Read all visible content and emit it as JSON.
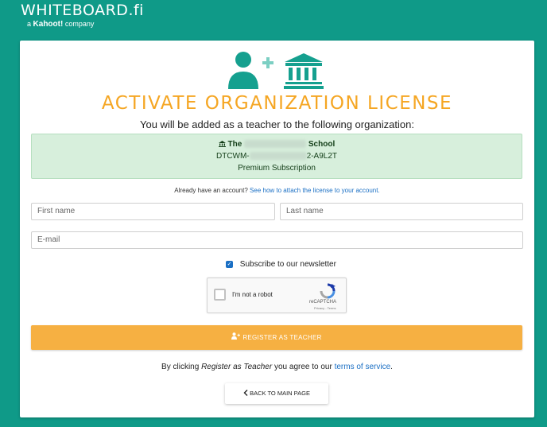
{
  "header": {
    "logo_text": "WHITEBOARD.fi",
    "tagline_prefix": "a",
    "tagline_brand": "Kahoot!",
    "tagline_suffix": "company"
  },
  "card": {
    "heading": "ACTIVATE ORGANIZATION LICENSE",
    "subheading": "You will be added as a teacher to the following organization:",
    "organization": {
      "name_prefix": "The",
      "name_suffix": "School",
      "code_prefix": "DTCWM-",
      "code_suffix": "2-A9L2T",
      "subscription": "Premium Subscription"
    },
    "have_account_text": "Already have an account?",
    "attach_link": "See how to attach the license to your account.",
    "form": {
      "first_name_placeholder": "First name",
      "last_name_placeholder": "Last name",
      "email_placeholder": "E-mail",
      "newsletter_label": "Subscribe to our newsletter",
      "newsletter_checked": true
    },
    "recaptcha": {
      "label": "I'm not a robot",
      "brand": "reCAPTCHA",
      "links": "Privacy - Terms"
    },
    "register_button": "REGISTER AS TEACHER",
    "terms": {
      "prefix": "By clicking",
      "button_ref": "Register as Teacher",
      "middle": "you agree to our",
      "link": "terms of service",
      "suffix": "."
    },
    "back_button": "BACK TO MAIN PAGE"
  },
  "colors": {
    "background": "#0f9a88",
    "accent_teal": "#15a08f",
    "heading_orange": "#f5a623",
    "button_orange": "#f6b042",
    "org_box_green": "#d7efdc",
    "link_blue": "#1a6fc4"
  },
  "icons": [
    "add-user-icon",
    "institution-icon",
    "bank-icon",
    "user-plus-icon",
    "chevron-left-icon",
    "recaptcha-logo-icon",
    "checkbox-checked-icon"
  ]
}
